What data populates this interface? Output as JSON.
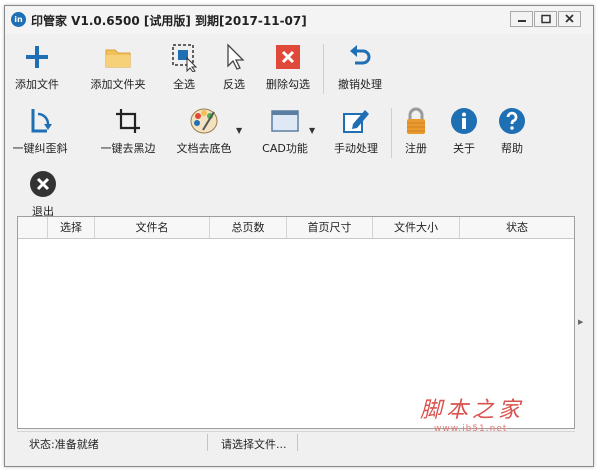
{
  "window": {
    "icon_text": "in",
    "title": "印管家 V1.0.6500 [试用版] 到期[2017-11-07]"
  },
  "toolbar_row1": [
    {
      "label": "添加文件"
    },
    {
      "label": "添加文件夹"
    },
    {
      "label": "全选"
    },
    {
      "label": "反选"
    },
    {
      "label": "删除勾选"
    },
    {
      "label": "撤销处理"
    }
  ],
  "toolbar_row2": [
    {
      "label": "一键纠歪斜"
    },
    {
      "label": "一键去黑边"
    },
    {
      "label": "文档去底色"
    },
    {
      "label": "CAD功能"
    },
    {
      "label": "手动处理"
    },
    {
      "label": "注册"
    },
    {
      "label": "关于"
    },
    {
      "label": "帮助"
    }
  ],
  "toolbar_row3": [
    {
      "label": "退出"
    }
  ],
  "table": {
    "columns": [
      "选择",
      "文件名",
      "总页数",
      "首页尺寸",
      "文件大小",
      "状态"
    ],
    "rows": []
  },
  "status": {
    "left": "状态:准备就绪",
    "right": "请选择文件..."
  },
  "watermark": {
    "main": "脚本之家",
    "sub": "www.jb51.net"
  },
  "colors": {
    "accent_blue": "#1f6fb5",
    "delete_red": "#e0493a",
    "lock_orange": "#e89a2c"
  }
}
